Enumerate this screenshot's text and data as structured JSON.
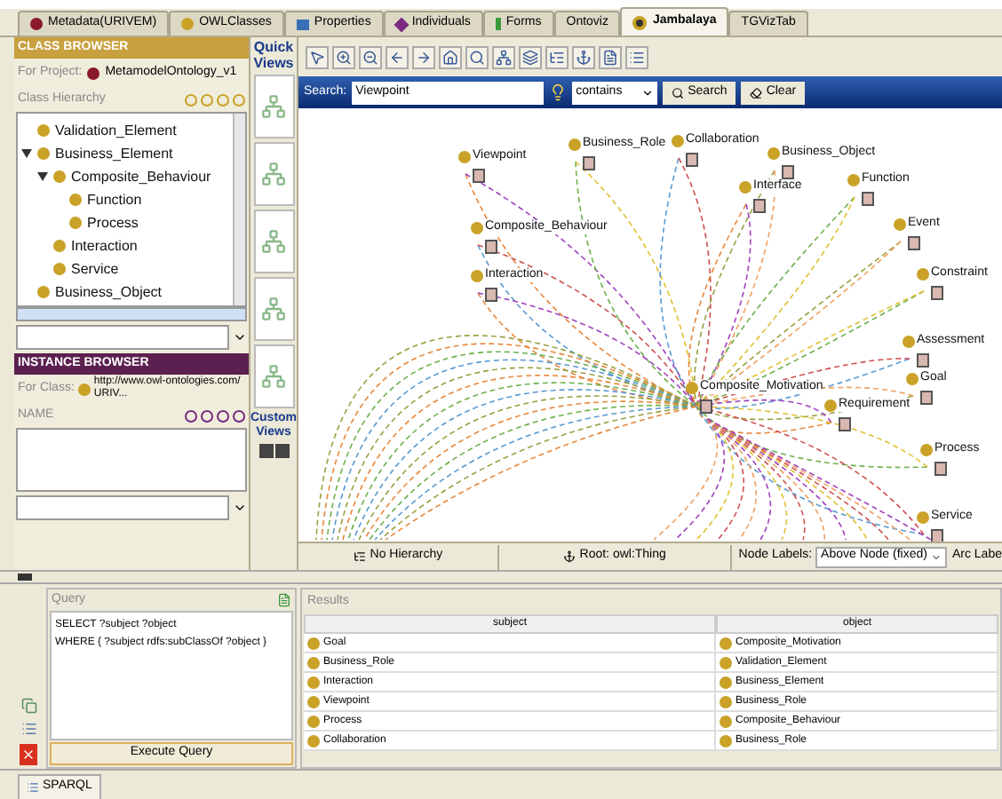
{
  "tabs": [
    {
      "label": "Metadata(URIVEM)",
      "kind": "maroon",
      "selected": false
    },
    {
      "label": "OWLClasses",
      "kind": "gold",
      "selected": false
    },
    {
      "label": "Properties",
      "kind": "blue",
      "selected": false
    },
    {
      "label": "Individuals",
      "kind": "purple",
      "selected": false
    },
    {
      "label": "Forms",
      "kind": "green",
      "selected": false
    },
    {
      "label": "Ontoviz",
      "kind": "none",
      "selected": false
    },
    {
      "label": "Jambalaya",
      "kind": "ring",
      "selected": true
    },
    {
      "label": "TGVizTab",
      "kind": "none",
      "selected": false
    }
  ],
  "class_browser": {
    "title": "CLASS BROWSER",
    "project_label": "For Project:",
    "project": "MetamodelOntology_v1",
    "hierarchy_label": "Class Hierarchy",
    "tree": [
      {
        "label": "Validation_Element"
      },
      {
        "label": "Business_Element",
        "expanded": true,
        "children": [
          {
            "label": "Composite_Behaviour",
            "expanded": true,
            "children": [
              {
                "label": "Function"
              },
              {
                "label": "Process"
              }
            ]
          },
          {
            "label": "Interaction"
          },
          {
            "label": "Service"
          }
        ]
      },
      {
        "label": "Business_Object"
      }
    ]
  },
  "instance_browser": {
    "title": "INSTANCE BROWSER",
    "class_label": "For Class:",
    "class": "http://www.owl-ontologies.com/URIV...",
    "name_label": "NAME"
  },
  "quick_views": {
    "title": "Quick Views",
    "custom_title": "Custom Views"
  },
  "search": {
    "label": "Search:",
    "value": "Viewpoint",
    "mode": "contains",
    "search_button": "Search",
    "clear_button": "Clear"
  },
  "graph": {
    "nodes": [
      "Viewpoint",
      "Business_Role",
      "Collaboration",
      "Business_Object",
      "Interface",
      "Function",
      "Composite_Behaviour",
      "Event",
      "Interaction",
      "Constraint",
      "Assessment",
      "Composite_Motivation",
      "Goal",
      "Requirement",
      "Process",
      "Service"
    ]
  },
  "graph_toolbar": {
    "hierarchy": "No Hierarchy",
    "root": "Root: owl:Thing",
    "node_labels_label": "Node Labels:",
    "node_labels": "Above Node (fixed)",
    "arc_labels": "Arc Labe"
  },
  "query": {
    "title": "Query",
    "text": [
      "SELECT ?subject ?object",
      "WHERE { ?subject rdfs:subClassOf ?object }"
    ],
    "execute": "Execute Query"
  },
  "results": {
    "title": "Results",
    "columns": [
      "subject",
      "object"
    ],
    "rows": [
      [
        "Goal",
        "Composite_Motivation"
      ],
      [
        "Business_Role",
        "Validation_Element"
      ],
      [
        "Interaction",
        "Business_Element"
      ],
      [
        "Viewpoint",
        "Business_Role"
      ],
      [
        "Process",
        "Composite_Behaviour"
      ],
      [
        "Collaboration",
        "Business_Role"
      ]
    ]
  },
  "bottom_tab": "SPARQL"
}
